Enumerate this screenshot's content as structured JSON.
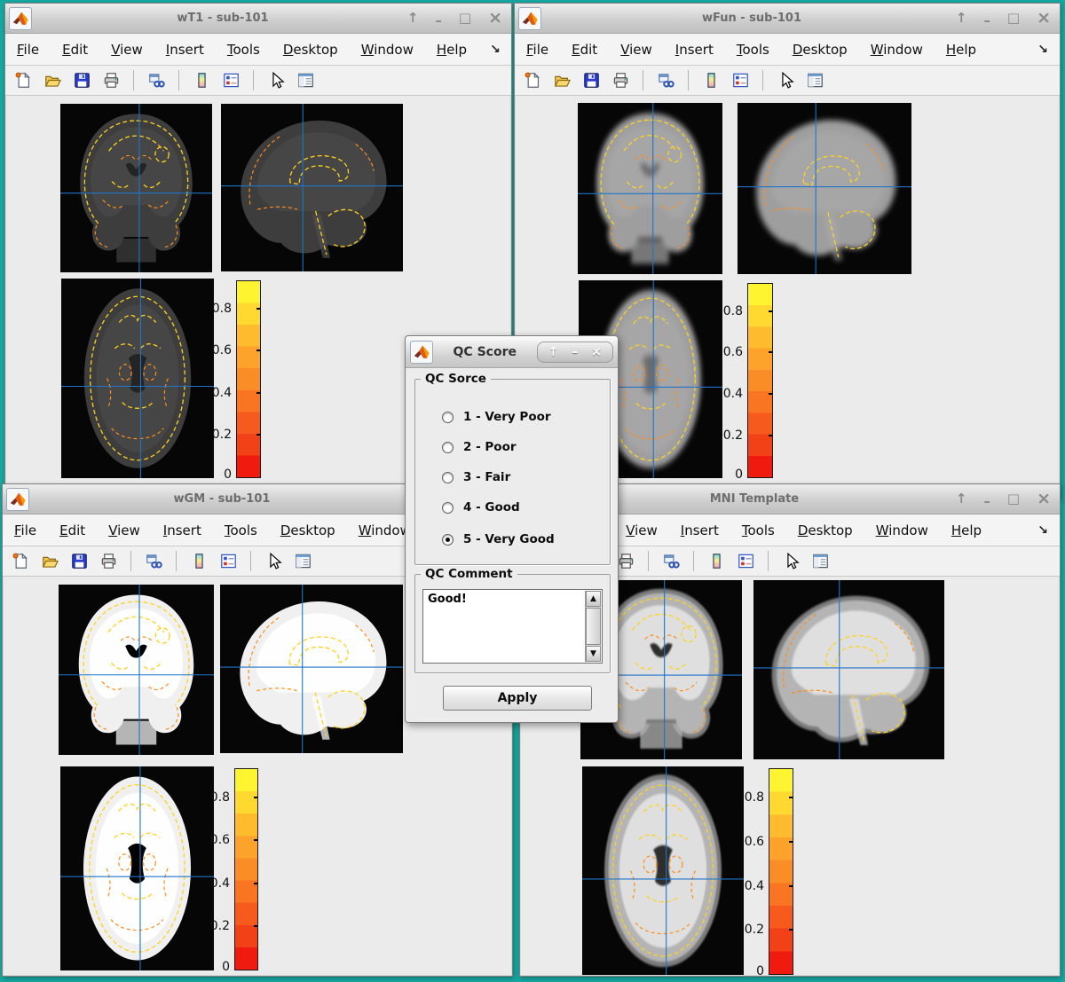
{
  "desktop": {
    "background": "#16a8a2"
  },
  "colors": {
    "crosshair_blue": "#1E74C9",
    "contour_yellow": "#FFD21E",
    "contour_orange": "#FF8C19"
  },
  "chrome": {
    "restore": "↑",
    "minimize": "–",
    "maximize": "□",
    "close": "×",
    "menu_overflow": "↘"
  },
  "menus": [
    "File",
    "Edit",
    "View",
    "Insert",
    "Tools",
    "Desktop",
    "Window",
    "Help"
  ],
  "toolbar_icons": [
    "new-figure",
    "open-file",
    "save-figure",
    "print-figure",
    "link-plot",
    "insert-colorbar",
    "insert-legend",
    "edit-plot-cursor",
    "plot-browser"
  ],
  "windows": {
    "wt1": {
      "title": "wT1 - sub-101"
    },
    "wfun": {
      "title": "wFun - sub-101"
    },
    "wgm": {
      "title": "wGM - sub-101"
    },
    "mni": {
      "title": "MNI Template"
    }
  },
  "colorbar": {
    "ticks": [
      "0.8",
      "0.6",
      "0.4",
      "0.2",
      "0"
    ],
    "bands": [
      "#FFF430",
      "#FFD930",
      "#FFBB2E",
      "#FDA32B",
      "#FB8D27",
      "#F97522",
      "#F65B1D",
      "#F34117",
      "#F01B0E"
    ]
  },
  "dialog": {
    "title": "QC Score",
    "score_group_label": "QC Sorce",
    "options": [
      {
        "label": "1 - Very Poor",
        "selected": false
      },
      {
        "label": "2 - Poor",
        "selected": false
      },
      {
        "label": "3 - Fair",
        "selected": false
      },
      {
        "label": "4 - Good",
        "selected": false
      },
      {
        "label": "5 - Very Good",
        "selected": true
      }
    ],
    "comment_group_label": "QC Comment",
    "comment_text": "Good!",
    "apply_label": "Apply",
    "scrollbar": {
      "up": "▲",
      "down": "▼"
    }
  }
}
